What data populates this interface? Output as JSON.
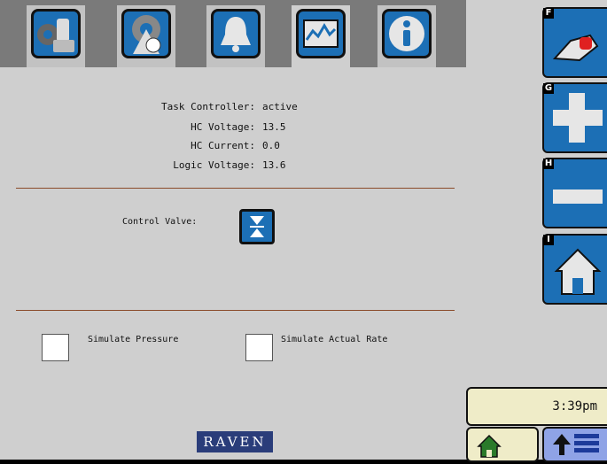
{
  "tabs": [
    {
      "name": "setup-tab",
      "icon": "tools-icon"
    },
    {
      "name": "product-tab",
      "icon": "gear-drop-icon"
    },
    {
      "name": "alarms-tab",
      "icon": "bell-icon"
    },
    {
      "name": "diagnostics-tab",
      "icon": "graph-icon"
    },
    {
      "name": "info-tab",
      "icon": "info-icon"
    }
  ],
  "status": {
    "task_controller_label": "Task Controller:",
    "task_controller_value": "active",
    "hc_voltage_label": "HC Voltage:",
    "hc_voltage_value": "13.5",
    "hc_current_label": "HC Current:",
    "hc_current_value": "0.0",
    "logic_voltage_label": "Logic Voltage:",
    "logic_voltage_value": "13.6"
  },
  "control_valve": {
    "label": "Control Valve:",
    "icon": "valve-close-icon"
  },
  "checkboxes": {
    "simulate_pressure": "Simulate Pressure",
    "simulate_actual_rate": "Simulate Actual Rate"
  },
  "brand": "RAVEN",
  "softkeys": [
    {
      "key": "F",
      "icon": "pointer-icon"
    },
    {
      "key": "G",
      "icon": "plus-icon"
    },
    {
      "key": "H",
      "icon": "minus-icon"
    },
    {
      "key": "I",
      "icon": "home-icon"
    }
  ],
  "clock": "3:39pm",
  "colors": {
    "accent": "#1c6fb5",
    "rule": "#8a4b2a",
    "brand_bg": "#2a3d7a",
    "clock_bg": "#efecc8"
  }
}
